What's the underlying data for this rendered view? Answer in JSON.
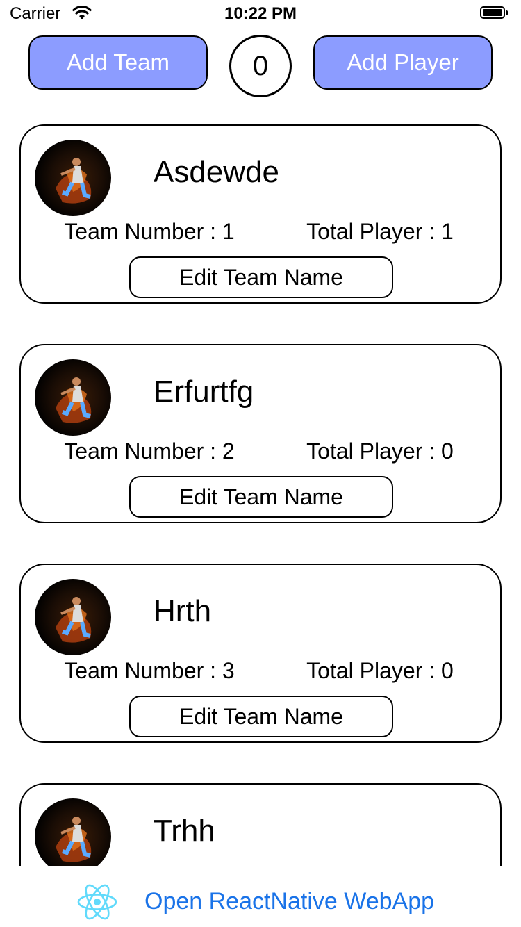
{
  "status_bar": {
    "carrier": "Carrier",
    "time": "10:22 PM",
    "wifi_icon": "wifi-icon",
    "battery_icon": "battery-icon"
  },
  "header": {
    "add_team_label": "Add Team",
    "counter_value": "0",
    "add_player_label": "Add Player",
    "button_color": "#8c9cff"
  },
  "teams": [
    {
      "name": "Asdewde",
      "team_number": "Team Number : 1",
      "total_player": "Total Player : 1",
      "edit_label": "Edit Team Name",
      "avatar_icon": "player-photo"
    },
    {
      "name": "Erfurtfg",
      "team_number": "Team Number : 2",
      "total_player": "Total Player : 0",
      "edit_label": "Edit Team Name",
      "avatar_icon": "player-photo"
    },
    {
      "name": "Hrth",
      "team_number": "Team Number : 3",
      "total_player": "Total Player : 0",
      "edit_label": "Edit Team Name",
      "avatar_icon": "player-photo"
    },
    {
      "name": "Trhh",
      "team_number": "",
      "total_player": "",
      "edit_label": "",
      "avatar_icon": "player-photo"
    }
  ],
  "footer": {
    "link_text": "Open ReactNative WebApp",
    "logo_icon": "react-logo-icon",
    "link_color": "#1a73e8",
    "logo_color": "#61dafb"
  }
}
